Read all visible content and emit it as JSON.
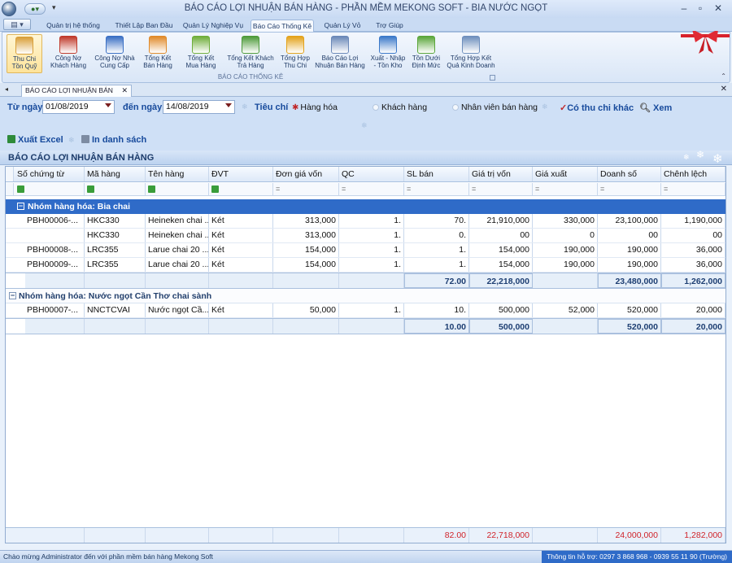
{
  "window": {
    "title": "BÁO CÁO LỢI NHUẬN BÁN HÀNG - PHẦN MỀM MEKONG SOFT - BIA NƯỚC NGỌT",
    "minimize": "–",
    "maximize": "▫",
    "close": "✕"
  },
  "ribbon_tabs": [
    "Quản trị hệ thống",
    "Thiết Lập Ban Đầu",
    "Quản Lý Nghiệp Vụ",
    "Báo Cáo Thống Kê",
    "Quản Lý Vỏ",
    "Trợ Giúp"
  ],
  "active_tab": "Báo Cáo Thống Kê",
  "ribbon_buttons": [
    {
      "label": "Thu Chi\nTồn Quỹ",
      "icon": "money-icon",
      "color": "#d9a03a"
    },
    {
      "label": "Công Nợ\nKhách Hàng",
      "icon": "customer-debt-icon",
      "color": "#c0392b"
    },
    {
      "label": "Công Nợ Nhà\nCung Cấp",
      "icon": "supplier-debt-icon",
      "color": "#3a6fc4"
    },
    {
      "label": "Tổng Kết\nBán Hàng",
      "icon": "sales-summary-icon",
      "color": "#e08a2a"
    },
    {
      "label": "Tổng Kết\nMua Hàng",
      "icon": "purchase-summary-icon",
      "color": "#6fae3a"
    },
    {
      "label": "Tổng Kết Khách\nTrả Hàng",
      "icon": "return-icon",
      "color": "#4d9a3a"
    },
    {
      "label": "Tổng Hợp\nThu Chi",
      "icon": "sigma-icon",
      "color": "#e3a21a"
    },
    {
      "label": "Báo Cáo Lợi\nNhuận Bán Hàng",
      "icon": "profit-report-icon",
      "color": "#6a88b8"
    },
    {
      "label": "Xuất - Nhập\n- Tồn Kho",
      "icon": "inventory-icon",
      "color": "#3b79c9"
    },
    {
      "label": "Tồn Dưới\nĐịnh Mức",
      "icon": "bar-chart-icon",
      "color": "#5aa63a"
    },
    {
      "label": "Tổng Hợp Kết\nQuả Kinh Doanh",
      "icon": "table-icon",
      "color": "#6e8fbd"
    }
  ],
  "ribbon_group_label": "BÁO CÁO THỐNG KÊ",
  "document_tab": "BÁO CÁO LỢI NHUẬN BÁN HÀNG",
  "filters": {
    "from_label": "Từ ngày",
    "from_value": "01/08/2019",
    "to_label": "đến ngày",
    "to_value": "14/08/2019",
    "criteria_label": "Tiêu chí",
    "opt_product": "Hàng hóa",
    "opt_customer": "Khách hàng",
    "opt_staff": "Nhân viên bán hàng",
    "opt_other": "Có thu chi khác",
    "view_label": "Xem",
    "export_label": "Xuất Excel",
    "print_label": "In danh sách"
  },
  "report_title": "BÁO CÁO LỢI NHUẬN BÁN HÀNG",
  "columns": [
    "Số chứng từ",
    "Mã hàng",
    "Tên hàng",
    "ĐVT",
    "Đơn giá vốn",
    "QC",
    "SL bán",
    "Giá trị vốn",
    "Giá xuất",
    "Doanh số",
    "Chênh lệch"
  ],
  "filter_symbol": "=",
  "groups": [
    {
      "title": "Nhóm hàng hóa: Bia chai",
      "rows": [
        [
          "PBH00006-...",
          "HKC330",
          "Heineken chai ...",
          "Két",
          "313,000",
          "1.",
          "70.",
          "21,910,000",
          "330,000",
          "23,100,000",
          "1,190,000"
        ],
        [
          "",
          "HKC330",
          "Heineken chai ...",
          "Két",
          "313,000",
          "1.",
          "0.",
          "00",
          "0",
          "00",
          "00"
        ],
        [
          "PBH00008-...",
          "LRC355",
          "Larue chai 20 ...",
          "Két",
          "154,000",
          "1.",
          "1.",
          "154,000",
          "190,000",
          "190,000",
          "36,000"
        ],
        [
          "PBH00009-...",
          "LRC355",
          "Larue chai 20 ...",
          "Két",
          "154,000",
          "1.",
          "1.",
          "154,000",
          "190,000",
          "190,000",
          "36,000"
        ]
      ],
      "totals": {
        "sl_ban": "72.00",
        "gia_tri_von": "22,218,000",
        "doanh_so": "23,480,000",
        "chenh_lech": "1,262,000"
      }
    },
    {
      "title": "Nhóm hàng hóa: Nước ngọt Cần Thơ chai sành",
      "rows": [
        [
          "PBH00007-...",
          "NNCTCVAI",
          "Nước ngọt Cầ...",
          "Két",
          "50,000",
          "1.",
          "10.",
          "500,000",
          "52,000",
          "520,000",
          "20,000"
        ]
      ],
      "totals": {
        "sl_ban": "10.00",
        "gia_tri_von": "500,000",
        "doanh_so": "520,000",
        "chenh_lech": "20,000"
      }
    }
  ],
  "grand_total": {
    "sl_ban": "82.00",
    "gia_tri_von": "22,718,000",
    "doanh_so": "24,000,000",
    "chenh_lech": "1,282,000"
  },
  "status": {
    "left": "Chào mừng Administrator đến với phần mềm bán hàng Mekong Soft",
    "right": "Thông tin hỗ trợ: 0297 3 868 968 - 0939 55 11 90 (Trường)"
  }
}
